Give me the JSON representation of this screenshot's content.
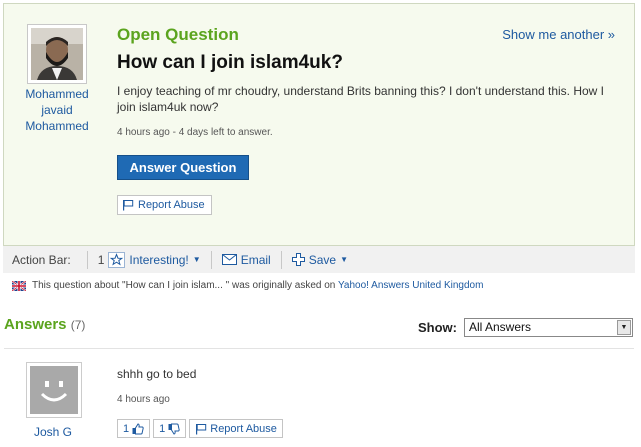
{
  "question": {
    "type_label": "Open Question",
    "show_another": "Show me another »",
    "title": "How can I join islam4uk?",
    "body": "I enjoy teaching of mr choudry, understand Brits banning this? I don't understand this. How I join islam4uk now?",
    "meta": "4 hours ago - 4 days left to answer.",
    "answer_button": "Answer Question",
    "report_abuse": "Report Abuse",
    "asker": {
      "name_line1": "Mohammed",
      "name_line2": "javaid",
      "name_line3": "Mohammed"
    }
  },
  "action_bar": {
    "label": "Action Bar:",
    "interesting_count": "1",
    "interesting_label": "Interesting!",
    "email_label": "Email",
    "save_label": "Save"
  },
  "origin": {
    "prefix": "This question about \"How can I join islam... \" was originally asked on",
    "site": "Yahoo! Answers United Kingdom"
  },
  "answers": {
    "heading": "Answers",
    "count": "(7)",
    "show_label": "Show:",
    "show_selected": "All Answers",
    "items": [
      {
        "author": "Josh G",
        "text": "shhh go to bed",
        "time": "4 hours ago",
        "thumbs_up": "1",
        "thumbs_down": "1",
        "report_abuse": "Report Abuse"
      }
    ]
  },
  "colors": {
    "accent_green": "#5ba41e",
    "link_blue": "#1e5aa0",
    "button_blue": "#1f6ab4"
  },
  "icons": [
    "flag-icon",
    "star-icon",
    "envelope-icon",
    "plus-icon",
    "uk-flag-icon",
    "thumbs-up-icon",
    "thumbs-down-icon",
    "smiley-avatar-icon"
  ]
}
